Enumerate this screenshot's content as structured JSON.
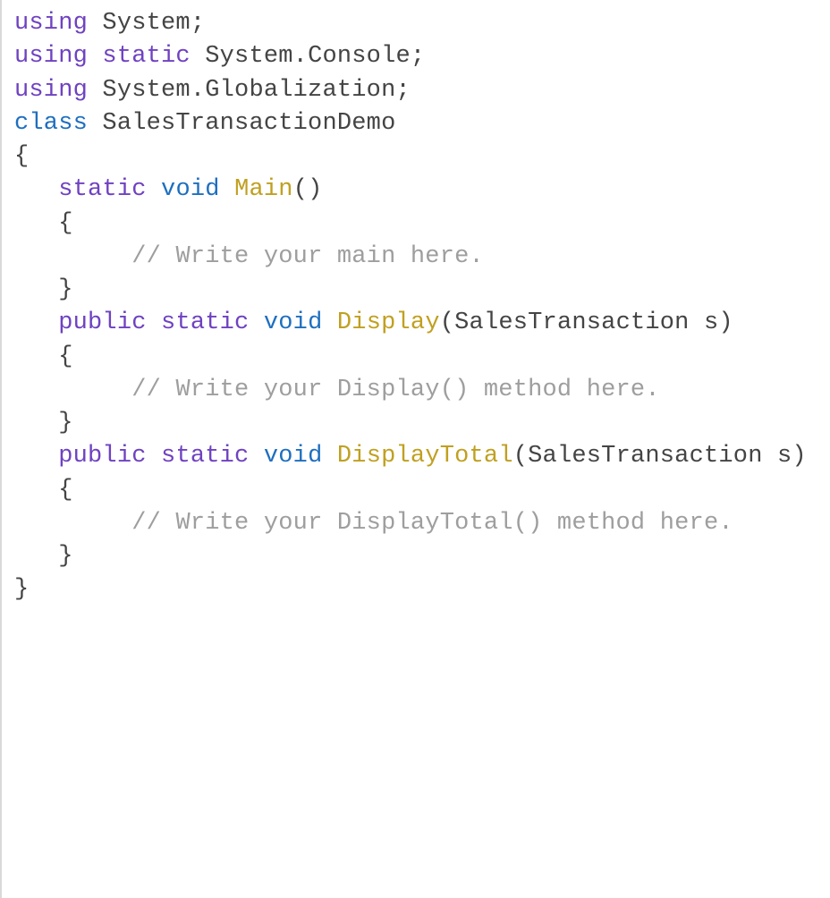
{
  "code": {
    "tokens": {
      "kw_using": "using",
      "kw_static": "static",
      "kw_class": "class",
      "kw_public": "public",
      "kw_void": "void",
      "ns_system": "System",
      "ns_system_console": "System.Console",
      "ns_system_globalization": "System.Globalization",
      "class_name": "SalesTransactionDemo",
      "fn_main": "Main",
      "fn_display": "Display",
      "fn_display_total": "DisplayTotal",
      "type_sales_transaction": "SalesTransaction",
      "param_s": "s",
      "brace_open": "{",
      "brace_close": "}",
      "paren_open": "(",
      "paren_close": ")",
      "semicolon": ";",
      "space": " ",
      "indent1": "   ",
      "indent2": "        ",
      "comment_main": "// Write your main here.",
      "comment_display": "// Write your Display() method here.",
      "comment_display_total_1": "// Write your DisplayTotal() method ",
      "comment_display_total_2": "here."
    }
  }
}
